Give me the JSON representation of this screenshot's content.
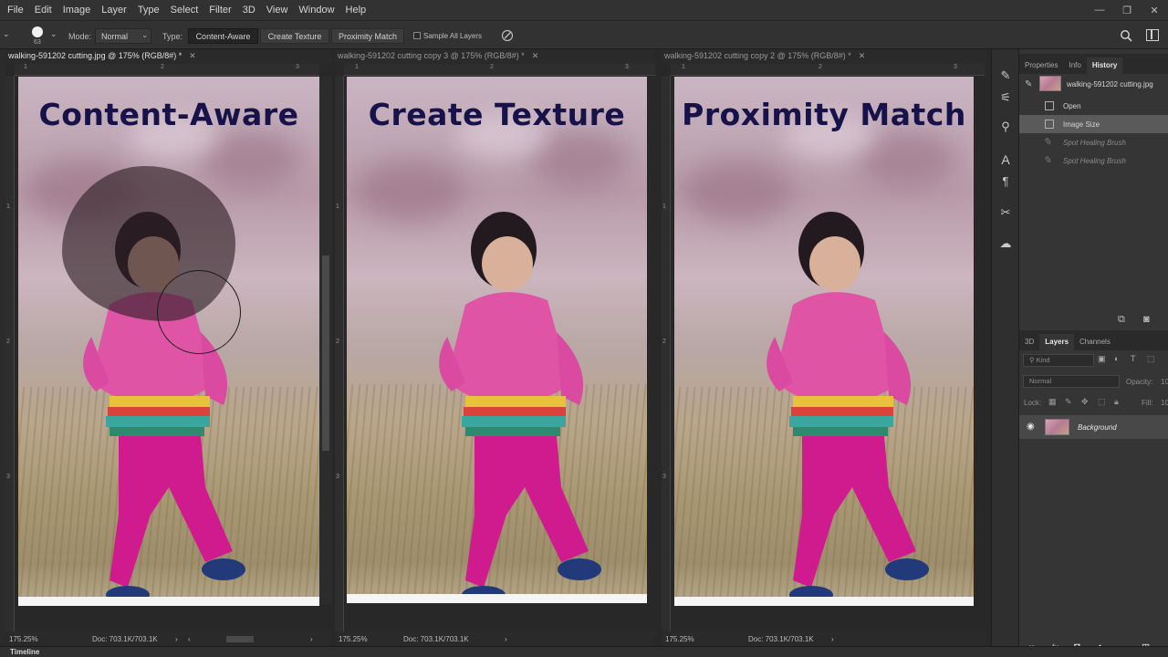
{
  "menu": [
    "File",
    "Edit",
    "Image",
    "Layer",
    "Type",
    "Select",
    "Filter",
    "3D",
    "View",
    "Window",
    "Help"
  ],
  "window_controls": [
    "—",
    "❐",
    "✕"
  ],
  "options": {
    "brush_size": "63",
    "mode_label": "Mode:",
    "mode_value": "Normal",
    "type_label": "Type:",
    "type_buttons": [
      "Content-Aware",
      "Create Texture",
      "Proximity Match"
    ],
    "sample_all_layers": "Sample All Layers"
  },
  "documents": [
    {
      "tab": "walking-591202 cutting.jpg @ 175% (RGB/8#) *",
      "overlay": "Content-Aware",
      "zoom": "175.25%",
      "doc_size": "Doc: 703.1K/703.1K",
      "ruler_h": [
        "1",
        "2",
        "3"
      ],
      "ruler_v": [
        "1",
        "2",
        "3"
      ]
    },
    {
      "tab": "walking-591202 cutting copy 3 @ 175% (RGB/8#) *",
      "overlay": "Create Texture",
      "zoom": "175.25%",
      "doc_size": "Doc: 703.1K/703.1K",
      "ruler_h": [
        "1",
        "2",
        "3"
      ],
      "ruler_v": [
        "1",
        "2",
        "3"
      ]
    },
    {
      "tab": "walking-591202 cutting copy 2 @ 175% (RGB/8#) *",
      "overlay": "Proximity Match",
      "zoom": "175.25%",
      "doc_size": "Doc: 703.1K/703.1K",
      "ruler_h": [
        "1",
        "2",
        "3"
      ],
      "ruler_v": [
        "1",
        "2",
        "3"
      ]
    }
  ],
  "right_panel": {
    "top_tabs": [
      "Properties",
      "Info",
      "History"
    ],
    "history_snapshot": "walking-591202 cutting.jpg",
    "history": [
      {
        "label": "Open",
        "state": "normal"
      },
      {
        "label": "Image Size",
        "state": "selected"
      },
      {
        "label": "Spot Healing Brush",
        "state": "undone"
      },
      {
        "label": "Spot Healing Brush",
        "state": "undone"
      }
    ],
    "layer_tabs": [
      "3D",
      "Layers",
      "Channels"
    ],
    "kind_label": "Kind",
    "blend_mode": "Normal",
    "opacity_label": "Opacity:",
    "opacity_value": "10",
    "lock_label": "Lock:",
    "fill_label": "Fill:",
    "fill_value": "10",
    "layer_name": "Background"
  },
  "bottom": {
    "timeline": "Timeline"
  },
  "colors": {
    "overlay_text": "#17134a",
    "accent_selection": "#5a5a5a"
  }
}
